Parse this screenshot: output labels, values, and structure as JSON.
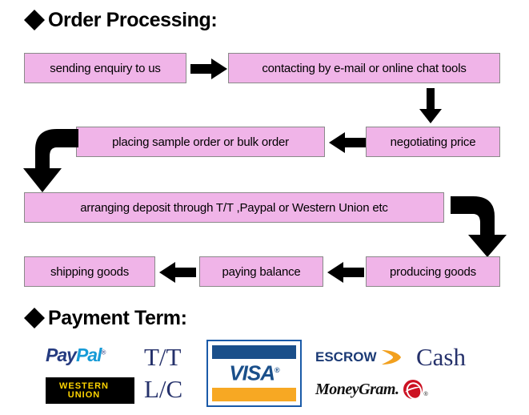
{
  "sections": {
    "order_processing": {
      "bullet": "diamond-bullet-icon",
      "title": "Order Processing:"
    },
    "payment_term": {
      "bullet": "diamond-bullet-icon",
      "title": "Payment Term:"
    }
  },
  "flowchart": {
    "boxes": [
      {
        "id": "sending-enquiry",
        "label": "sending enquiry to us"
      },
      {
        "id": "contacting",
        "label": "contacting by e-mail or online chat tools"
      },
      {
        "id": "negotiating-price",
        "label": "negotiating price"
      },
      {
        "id": "placing-order",
        "label": "placing sample order or bulk order"
      },
      {
        "id": "arranging-deposit",
        "label": "arranging deposit through T/T ,Paypal or Western Union etc"
      },
      {
        "id": "producing-goods",
        "label": "producing goods"
      },
      {
        "id": "paying-balance",
        "label": "paying balance"
      },
      {
        "id": "shipping-goods",
        "label": "shipping goods"
      }
    ],
    "arrows": [
      {
        "id": "arrow-enquiry-to-contacting",
        "icon": "arrow-right-icon"
      },
      {
        "id": "arrow-contacting-to-negotiating",
        "icon": "arrow-down-icon"
      },
      {
        "id": "arrow-negotiating-to-placing",
        "icon": "arrow-left-icon"
      },
      {
        "id": "arrow-placing-to-deposit",
        "icon": "elbow-arrow-left-down-icon"
      },
      {
        "id": "arrow-deposit-to-producing",
        "icon": "elbow-arrow-right-down-icon"
      },
      {
        "id": "arrow-producing-to-paying",
        "icon": "arrow-left-icon"
      },
      {
        "id": "arrow-paying-to-shipping",
        "icon": "arrow-left-icon"
      }
    ],
    "box_fill_color": "#f0b4e8",
    "box_border_color": "#8a8a8a",
    "arrow_color": "#000000"
  },
  "payment_methods": [
    {
      "id": "paypal",
      "type": "logo",
      "label": "PayPal",
      "part1": "Pay",
      "part2": "Pal",
      "mark": "®",
      "colors": [
        "#253b80",
        "#179bd7"
      ]
    },
    {
      "id": "tt",
      "type": "text",
      "label": "T/T",
      "color": "#25316b"
    },
    {
      "id": "visa",
      "type": "logo",
      "label": "VISA",
      "mark": "®",
      "colors": [
        "#1a4f8a",
        "#f7a823"
      ]
    },
    {
      "id": "escrow",
      "type": "logo",
      "label": "ESCROW",
      "color": "#1b3a75",
      "accent": "#f2a01e"
    },
    {
      "id": "cash",
      "type": "text",
      "label": "Cash",
      "color": "#25316b"
    },
    {
      "id": "western-union",
      "type": "logo",
      "line1": "WESTERN",
      "line2": "UNION",
      "label": "WESTERN UNION",
      "colors": [
        "#000000",
        "#ffd400"
      ]
    },
    {
      "id": "lc",
      "type": "text",
      "label": "L/C",
      "color": "#25316b"
    },
    {
      "id": "moneygram",
      "type": "logo",
      "label": "MoneyGram",
      "mark": ".",
      "reg": "®",
      "colors": [
        "#111111",
        "#cc1122"
      ]
    }
  ]
}
